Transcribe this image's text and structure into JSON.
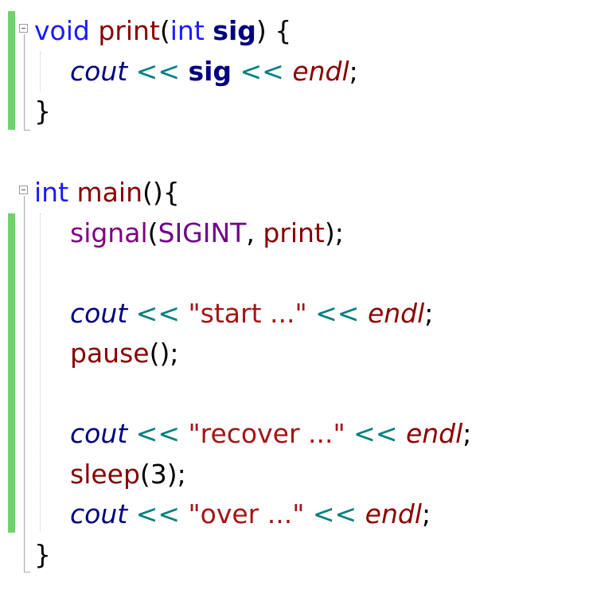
{
  "editor": {
    "lines": [
      [
        {
          "t": "void",
          "c": "kw"
        },
        {
          "t": " ",
          "c": "punc"
        },
        {
          "t": "print",
          "c": "fn"
        },
        {
          "t": "(",
          "c": "punc"
        },
        {
          "t": "int",
          "c": "kw"
        },
        {
          "t": " ",
          "c": "punc"
        },
        {
          "t": "sig",
          "c": "param"
        },
        {
          "t": ") {",
          "c": "punc"
        }
      ],
      [
        {
          "t": "cout",
          "c": "obj"
        },
        {
          "t": " << ",
          "c": "op"
        },
        {
          "t": "sig",
          "c": "param"
        },
        {
          "t": " << ",
          "c": "op"
        },
        {
          "t": "endl",
          "c": "manip"
        },
        {
          "t": ";",
          "c": "punc"
        }
      ],
      [
        {
          "t": "}",
          "c": "punc"
        }
      ],
      [],
      [
        {
          "t": "int",
          "c": "kw"
        },
        {
          "t": " ",
          "c": "punc"
        },
        {
          "t": "main",
          "c": "fn"
        },
        {
          "t": "(){",
          "c": "punc"
        }
      ],
      [
        {
          "t": "signal",
          "c": "call"
        },
        {
          "t": "(",
          "c": "punc"
        },
        {
          "t": "SIGINT",
          "c": "macro"
        },
        {
          "t": ", ",
          "c": "punc"
        },
        {
          "t": "print",
          "c": "fn"
        },
        {
          "t": ");",
          "c": "punc"
        }
      ],
      [],
      [
        {
          "t": "cout",
          "c": "obj"
        },
        {
          "t": " << ",
          "c": "op"
        },
        {
          "t": "\"start ...\"",
          "c": "str"
        },
        {
          "t": " << ",
          "c": "op"
        },
        {
          "t": "endl",
          "c": "manip"
        },
        {
          "t": ";",
          "c": "punc"
        }
      ],
      [
        {
          "t": "pause",
          "c": "fn"
        },
        {
          "t": "();",
          "c": "punc"
        }
      ],
      [],
      [
        {
          "t": "cout",
          "c": "obj"
        },
        {
          "t": " << ",
          "c": "op"
        },
        {
          "t": "\"recover ...\"",
          "c": "str"
        },
        {
          "t": " << ",
          "c": "op"
        },
        {
          "t": "endl",
          "c": "manip"
        },
        {
          "t": ";",
          "c": "punc"
        }
      ],
      [
        {
          "t": "sleep",
          "c": "fn"
        },
        {
          "t": "(3);",
          "c": "punc"
        }
      ],
      [
        {
          "t": "cout",
          "c": "obj"
        },
        {
          "t": " << ",
          "c": "op"
        },
        {
          "t": "\"over ...\"",
          "c": "str"
        },
        {
          "t": " << ",
          "c": "op"
        },
        {
          "t": "endl",
          "c": "manip"
        },
        {
          "t": ";",
          "c": "punc"
        }
      ],
      [
        {
          "t": "}",
          "c": "punc"
        }
      ]
    ]
  },
  "colors": {
    "keyword": "#1a1aff",
    "function": "#880000",
    "parameter": "#000080",
    "object": "#000080",
    "operator": "#008080",
    "manipulator": "#8b0000",
    "string": "#a31515",
    "macro": "#6f008a",
    "changed_marker": "#6fd36a"
  }
}
